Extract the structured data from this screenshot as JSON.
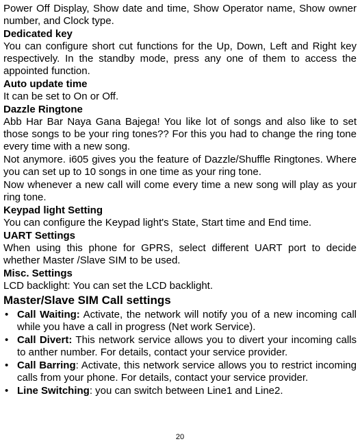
{
  "intro": "Power Off Display, Show date and time, Show Operator name, Show owner number, and Clock type.",
  "sections": {
    "dedicated_key": {
      "title": "Dedicated key",
      "body": "You can configure short cut functions for the Up, Down, Left and Right key respectively. In the standby mode, press any one of them to access the appointed function."
    },
    "auto_update_time": {
      "title": "Auto update time",
      "body": "It can be set to On or Off."
    },
    "dazzle_ringtone": {
      "title": "Dazzle Ringtone",
      "p1": "Abb Har Bar Naya Gana Bajega! You like lot of songs and also like to set those songs to be your ring tones?? For this you had to change the ring tone every time with a new song.",
      "p2": "Not anymore. i605 gives you the feature of Dazzle/Shuffle Ringtones. Where you can set up to 10 songs in one time as your ring tone.",
      "p3": "Now whenever a new call will come every time a new song will play as your ring tone."
    },
    "keypad_light": {
      "title": "Keypad light Setting",
      "body": "You can configure the Keypad light's State, Start time and End time."
    },
    "uart": {
      "title": "UART Settings",
      "body": "When using this phone for GPRS, select different UART port to decide whether Master /Slave SIM to be used."
    },
    "misc": {
      "title": "Misc. Settings",
      "body": "LCD backlight: You can set the LCD backlight."
    }
  },
  "master_slave": {
    "title": "Master/Slave SIM Call settings",
    "items": {
      "call_waiting": {
        "label": "Call Waiting:",
        "desc": " Activate, the network will notify you of a new incoming call while you have a call in progress (Net work Service)."
      },
      "call_divert": {
        "label": "Call Divert:",
        "desc": " This network service allows you to divert your incoming calls to anther number. For details, contact your service provider."
      },
      "call_barring": {
        "label": "Call Barring",
        "desc": ": Activate, this network service allows you to restrict incoming calls from your phone. For details, contact your service provider."
      },
      "line_switching": {
        "label": "Line Switching",
        "desc": ": you can switch between Line1 and Line2."
      }
    }
  },
  "page_number": "20"
}
